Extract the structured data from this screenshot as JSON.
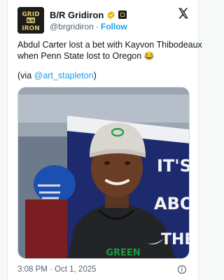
{
  "author": {
    "name": "B/R Gridiron",
    "handle": "@brgridiron",
    "separator": "·",
    "follow_label": "Follow",
    "avatar_text_top": "GRID",
    "avatar_text_mid": "B/R",
    "avatar_text_bottom": "IRON",
    "verified_color": "#e8b400",
    "icons": [
      "verified-badge-icon",
      "affiliate-badge-icon",
      "x-logo-icon"
    ]
  },
  "tweet": {
    "line1": "Abdul Carter lost a bet with Kayvon Thibodeaux",
    "line2": "when Penn State lost to Oregon",
    "line2_emoji": "😂",
    "via_open": "(via ",
    "via_mention": "@art_stapleton",
    "via_close": ")"
  },
  "media": {
    "banner_line1": "IT'S",
    "banner_line2": "ABO",
    "banner_line3": "THE",
    "shirt_text": "GREEN",
    "hat_logo": "O"
  },
  "footer": {
    "timestamp": "3:08 PM · Oct 1, 2025",
    "info_icon": "info-icon"
  },
  "colors": {
    "link": "#1d9bf0",
    "secondary_text": "#536471",
    "oregon_green": "#1f9a3c",
    "banner_blue": "#1d2a6e"
  }
}
